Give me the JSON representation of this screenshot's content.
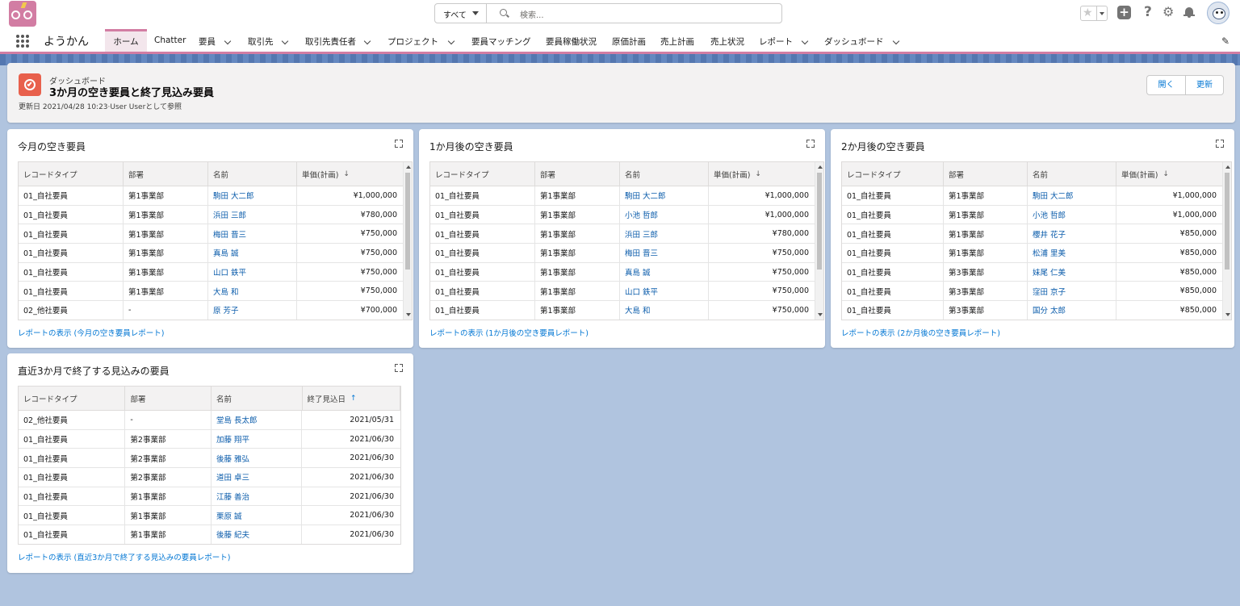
{
  "header": {
    "search_scope": "すべて",
    "search_placeholder": "検索..."
  },
  "nav": {
    "app_name": "ようかん",
    "items": [
      {
        "label": "ホーム",
        "active": true
      },
      {
        "label": "Chatter"
      },
      {
        "label": "要員",
        "dropdown": true
      },
      {
        "label": "取引先",
        "dropdown": true
      },
      {
        "label": "取引先責任者",
        "dropdown": true
      },
      {
        "label": "プロジェクト",
        "dropdown": true
      },
      {
        "label": "要員マッチング"
      },
      {
        "label": "要員稼働状況"
      },
      {
        "label": "原価計画"
      },
      {
        "label": "売上計画"
      },
      {
        "label": "売上状況"
      },
      {
        "label": "レポート",
        "dropdown": true
      },
      {
        "label": "ダッシュボード",
        "dropdown": true
      }
    ]
  },
  "dashboard": {
    "subtitle": "ダッシュボード",
    "title": "3か月の空き要員と終了見込み要員",
    "meta": "更新日 2021/04/28 10:23·User Userとして参照",
    "open_button": "開く",
    "refresh_button": "更新"
  },
  "cards": [
    {
      "title": "今月の空き要員",
      "headers": [
        "レコードタイプ",
        "部署",
        "名前",
        "単価(計画)"
      ],
      "sort": "↓",
      "rows": [
        [
          "01_自社要員",
          "第1事業部",
          "駒田 大二郎",
          "¥1,000,000"
        ],
        [
          "01_自社要員",
          "第1事業部",
          "浜田 三郎",
          "¥780,000"
        ],
        [
          "01_自社要員",
          "第1事業部",
          "梅田 晋三",
          "¥750,000"
        ],
        [
          "01_自社要員",
          "第1事業部",
          "真島 誠",
          "¥750,000"
        ],
        [
          "01_自社要員",
          "第1事業部",
          "山口 鉄平",
          "¥750,000"
        ],
        [
          "01_自社要員",
          "第1事業部",
          "大島 和",
          "¥750,000"
        ],
        [
          "02_他社要員",
          "-",
          "原 芳子",
          "¥700,000"
        ]
      ],
      "link": "レポートの表示 (今月の空き要員レポート)"
    },
    {
      "title": "1か月後の空き要員",
      "headers": [
        "レコードタイプ",
        "部署",
        "名前",
        "単価(計画)"
      ],
      "sort": "↓",
      "rows": [
        [
          "01_自社要員",
          "第1事業部",
          "駒田 大二郎",
          "¥1,000,000"
        ],
        [
          "01_自社要員",
          "第1事業部",
          "小池 哲郎",
          "¥1,000,000"
        ],
        [
          "01_自社要員",
          "第1事業部",
          "浜田 三郎",
          "¥780,000"
        ],
        [
          "01_自社要員",
          "第1事業部",
          "梅田 晋三",
          "¥750,000"
        ],
        [
          "01_自社要員",
          "第1事業部",
          "真島 誠",
          "¥750,000"
        ],
        [
          "01_自社要員",
          "第1事業部",
          "山口 鉄平",
          "¥750,000"
        ],
        [
          "01_自社要員",
          "第1事業部",
          "大島 和",
          "¥750,000"
        ]
      ],
      "link": "レポートの表示 (1か月後の空き要員レポート)"
    },
    {
      "title": "2か月後の空き要員",
      "headers": [
        "レコードタイプ",
        "部署",
        "名前",
        "単価(計画)"
      ],
      "sort": "↓",
      "rows": [
        [
          "01_自社要員",
          "第1事業部",
          "駒田 大二郎",
          "¥1,000,000"
        ],
        [
          "01_自社要員",
          "第1事業部",
          "小池 哲郎",
          "¥1,000,000"
        ],
        [
          "01_自社要員",
          "第1事業部",
          "櫻井 花子",
          "¥850,000"
        ],
        [
          "01_自社要員",
          "第1事業部",
          "松浦 里美",
          "¥850,000"
        ],
        [
          "01_自社要員",
          "第3事業部",
          "妹尾 仁美",
          "¥850,000"
        ],
        [
          "01_自社要員",
          "第3事業部",
          "窪田 京子",
          "¥850,000"
        ],
        [
          "01_自社要員",
          "第3事業部",
          "国分 太郎",
          "¥850,000"
        ]
      ],
      "link": "レポートの表示 (2か月後の空き要員レポート)"
    },
    {
      "title": "直近3か月で終了する見込みの要員",
      "headers": [
        "レコードタイプ",
        "部署",
        "名前",
        "終了見込日"
      ],
      "sort": "↑",
      "rows": [
        [
          "02_他社要員",
          "-",
          "堂島 長太郎",
          "2021/05/31"
        ],
        [
          "01_自社要員",
          "第2事業部",
          "加藤 翔平",
          "2021/06/30"
        ],
        [
          "01_自社要員",
          "第2事業部",
          "後藤 雅弘",
          "2021/06/30"
        ],
        [
          "01_自社要員",
          "第2事業部",
          "道田 卓三",
          "2021/06/30"
        ],
        [
          "01_自社要員",
          "第1事業部",
          "江藤 善治",
          "2021/06/30"
        ],
        [
          "01_自社要員",
          "第1事業部",
          "栗原 誠",
          "2021/06/30"
        ],
        [
          "01_自社要員",
          "第1事業部",
          "後藤 紀夫",
          "2021/06/30"
        ]
      ],
      "link": "レポートの表示 (直近3か月で終了する見込みの要員レポート)"
    }
  ]
}
